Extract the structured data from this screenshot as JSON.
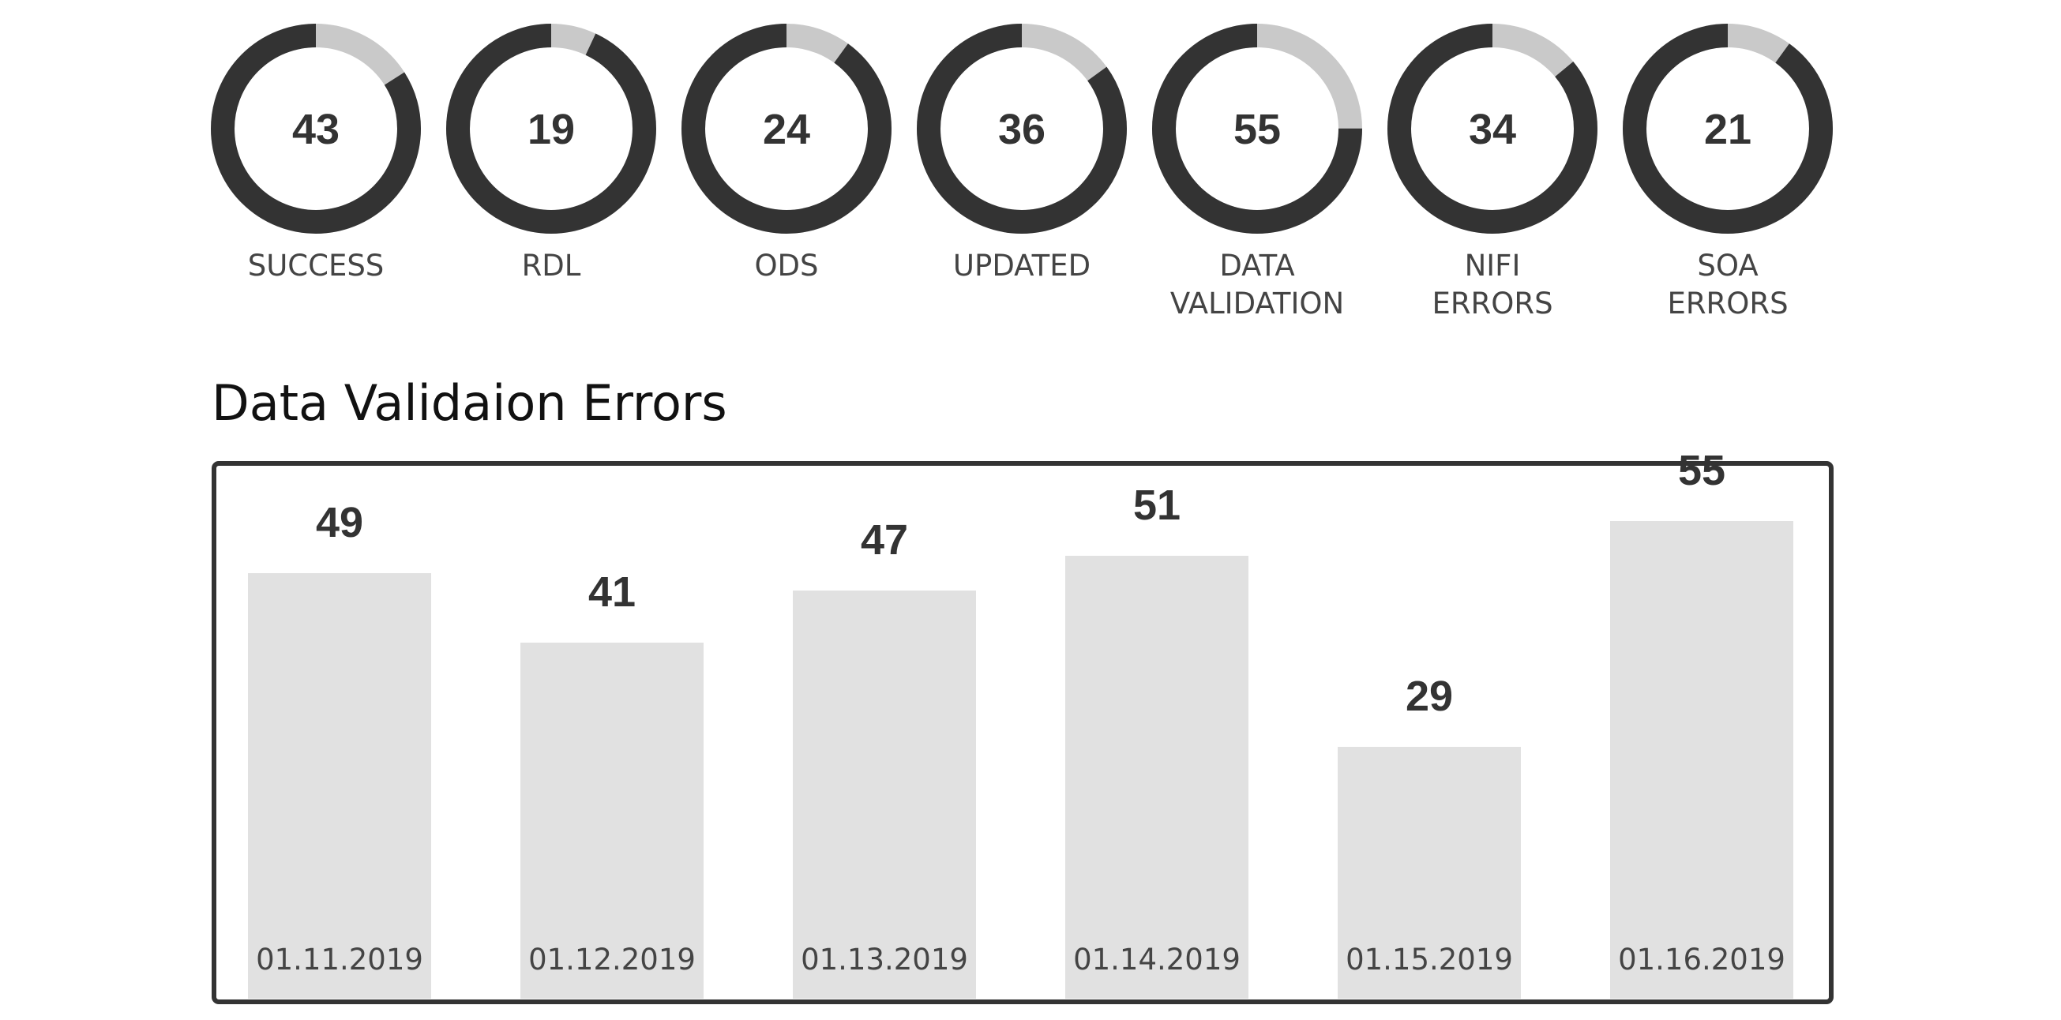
{
  "colors": {
    "ring_dark": "#333333",
    "ring_light": "#c9c9c9",
    "bar_fill": "#e1e1e1",
    "frame": "#333333",
    "text": "#333333"
  },
  "summary": {
    "items": [
      {
        "value": "43",
        "label_lines": [
          "SUCCESS"
        ],
        "dark_fraction": 0.84
      },
      {
        "value": "19",
        "label_lines": [
          "RDL"
        ],
        "dark_fraction": 0.93
      },
      {
        "value": "24",
        "label_lines": [
          "ODS"
        ],
        "dark_fraction": 0.9
      },
      {
        "value": "36",
        "label_lines": [
          "UPDATED"
        ],
        "dark_fraction": 0.85
      },
      {
        "value": "55",
        "label_lines": [
          "DATA",
          "VALIDATION"
        ],
        "dark_fraction": 0.75
      },
      {
        "value": "34",
        "label_lines": [
          "NIFI",
          "ERRORS"
        ],
        "dark_fraction": 0.86
      },
      {
        "value": "21",
        "label_lines": [
          "SOA",
          "ERRORS"
        ],
        "dark_fraction": 0.9
      }
    ]
  },
  "chart_data": {
    "type": "bar",
    "title": "Data Validaion Errors",
    "categories": [
      "01.11.2019",
      "01.12.2019",
      "01.13.2019",
      "01.14.2019",
      "01.15.2019",
      "01.16.2019"
    ],
    "values": [
      49,
      41,
      47,
      51,
      29,
      55
    ],
    "xlabel": "",
    "ylabel": "",
    "ylim": [
      0,
      70
    ],
    "grid": false,
    "legend": "none"
  }
}
